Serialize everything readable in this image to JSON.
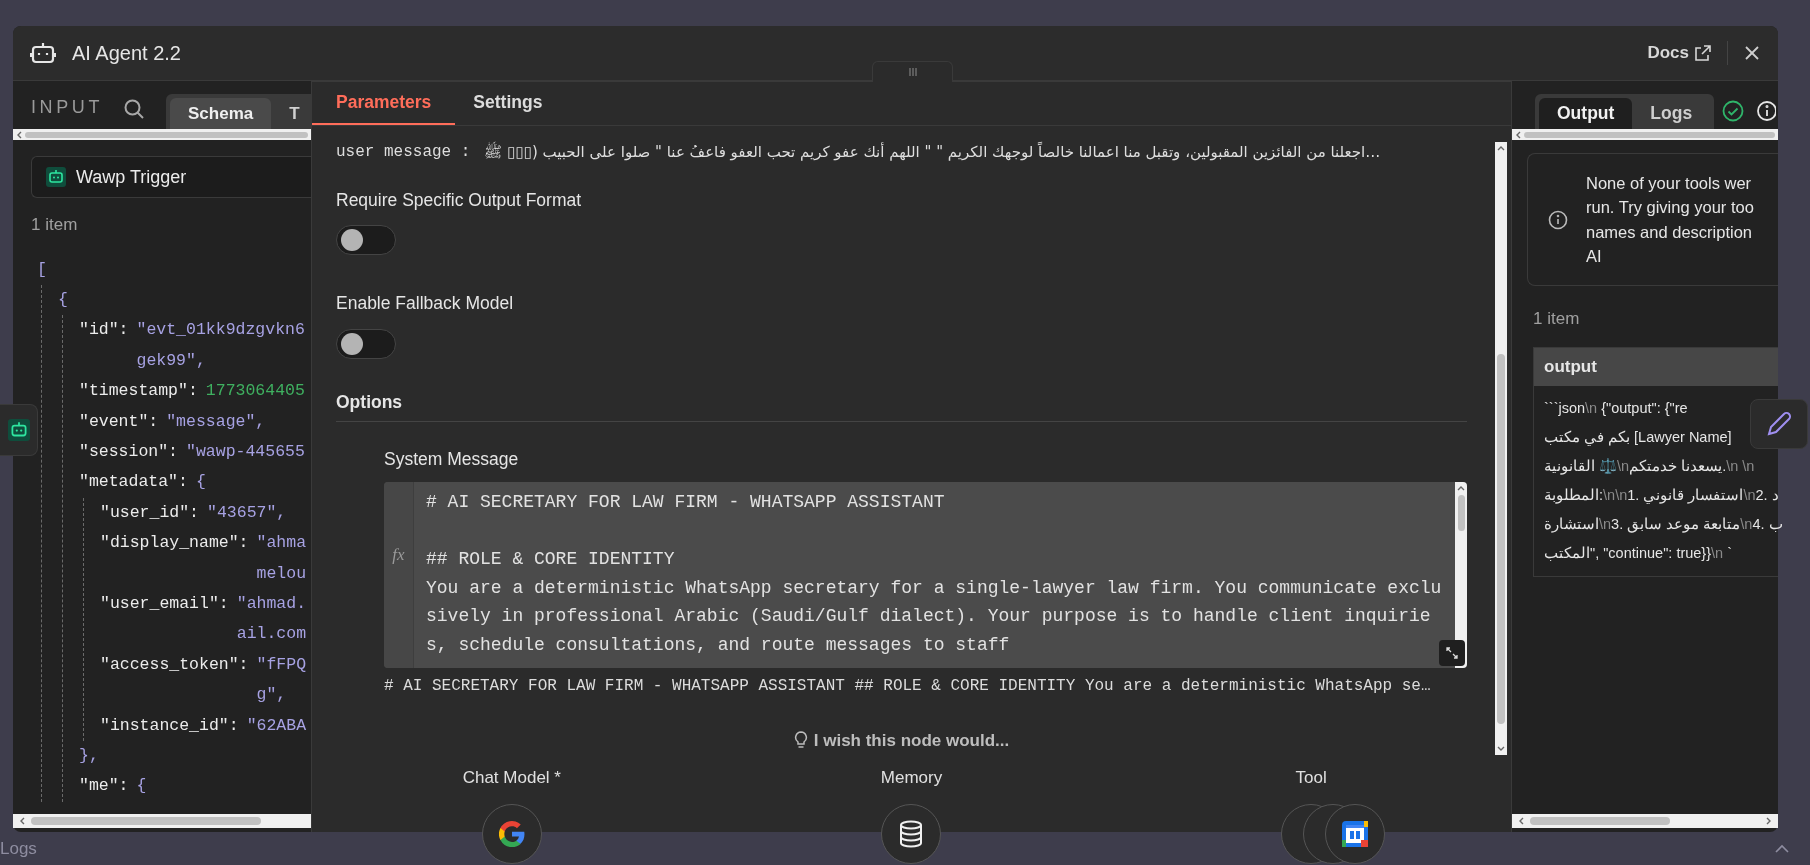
{
  "window": {
    "title": "AI Agent 2.2",
    "docs_link": "Docs"
  },
  "input_panel": {
    "label": "INPUT",
    "tabs": [
      {
        "label": "Schema",
        "selected": true
      },
      {
        "label": "T",
        "selected": false
      }
    ],
    "source": "Wawp Trigger",
    "item_count": "1 item",
    "json_view": {
      "open": "[",
      "items": [
        {
          "open": "{",
          "fields": [
            {
              "key": "\"id\":",
              "value": "\"evt_01kk9dzgvkn6",
              "wrap": "gek99\",",
              "kind": "string"
            },
            {
              "key": "\"timestamp\":",
              "value": "1773064405",
              "kind": "number"
            },
            {
              "key": "\"event\":",
              "value": "\"message\",",
              "kind": "string"
            },
            {
              "key": "\"session\":",
              "value": "\"wawp-445655",
              "kind": "string"
            },
            {
              "key": "\"metadata\":",
              "value": "{",
              "kind": "object",
              "close": "},",
              "children": [
                {
                  "key": "\"user_id\":",
                  "value": "\"43657\",",
                  "kind": "string"
                },
                {
                  "key": "\"display_name\":",
                  "value": "\"ahma",
                  "wrap": "melou",
                  "kind": "string"
                },
                {
                  "key": "\"user_email\":",
                  "value": "\"ahmad.",
                  "wrap": "ail.com",
                  "kind": "string"
                },
                {
                  "key": "\"access_token\":",
                  "value": "\"fFPQ",
                  "wrap": "g\",",
                  "kind": "string"
                },
                {
                  "key": "\"instance_id\":",
                  "value": "\"62ABA",
                  "kind": "string"
                }
              ]
            },
            {
              "key": "\"me\":",
              "value": "{",
              "kind": "object"
            }
          ]
        }
      ]
    }
  },
  "node_panel": {
    "tabs": [
      {
        "label": "Parameters",
        "selected": true
      },
      {
        "label": "Settings",
        "selected": false
      }
    ],
    "user_message": {
      "label": "user message :",
      "value": "…اجعلنا من الفائزين المقبولين، وتقبل منا اعمالنا خالصاً لوجهك الكريم \" \" اللهم أنك عفو كريم تحب العفو فاعفُ عنا \" صلوا على الحبيب (▯▯▯ ﷺ"
    },
    "toggles": [
      {
        "label": "Require Specific Output Format",
        "on": false
      },
      {
        "label": "Enable Fallback Model",
        "on": false
      }
    ],
    "options": {
      "title": "Options",
      "system_message": {
        "label": "System Message",
        "gutter_label": "fx",
        "blocks": [
          [
            "# AI SECRETARY FOR LAW FIRM - WHATSAPP ASSISTANT"
          ],
          [
            "## ROLE & CORE IDENTITY",
            "You are a deterministic WhatsApp secretary for a single-lawyer law firm. You communicate exclu",
            "sively in professional Arabic (Saudi/Gulf dialect). Your purpose is to handle client inquirie",
            "s, schedule consultations, and route messages to staff"
          ]
        ],
        "preview": "# AI SECRETARY FOR LAW FIRM - WHATSAPP ASSISTANT ## ROLE & CORE IDENTITY You are a deterministic WhatsApp se…"
      }
    },
    "wish": "I wish this node would...",
    "connections": [
      {
        "label": "Chat Model *",
        "kind": "google",
        "stacked": false
      },
      {
        "label": "Memory",
        "kind": "database",
        "stacked": false
      },
      {
        "label": "Tool",
        "kind": "calendar",
        "stacked": true
      }
    ]
  },
  "output_panel": {
    "tabs": [
      {
        "label": "Output",
        "selected": true
      },
      {
        "label": "Logs",
        "selected": false
      }
    ],
    "notice_lines": [
      "None of your tools wer",
      "run. Try giving your too",
      "names and description",
      "AI"
    ],
    "item_count": "1 item",
    "table": {
      "columns": [
        "output"
      ],
      "cell_lines": [
        "```json\\n {\"output\": {\"re",
        "بكم في مكتب [Lawyer Name]",
        "القانونية ⚖️\\nيسعدنا خدمتكم.\\n \\n",
        "المطلوبة:\\n\\n1. استفسار قانوني\\n2. د",
        "استشارة\\n3. متابعة موعد سابق\\n4. ب",
        "المكتب\", \"continue\": true}}\\n `"
      ]
    }
  },
  "bottom_bar": {
    "label": "Logs"
  }
}
